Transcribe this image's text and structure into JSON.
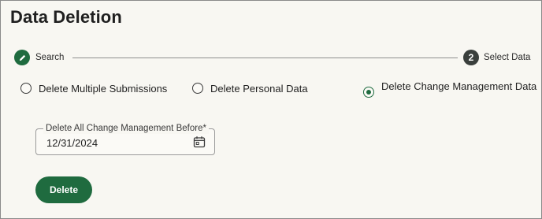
{
  "page": {
    "title": "Data Deletion"
  },
  "stepper": {
    "steps": [
      {
        "label": "Search",
        "icon": "pencil-icon",
        "state": "completed"
      },
      {
        "label": "Select Data",
        "number": "2",
        "state": "active"
      }
    ]
  },
  "options": {
    "items": [
      {
        "label": "Delete Multiple Submissions",
        "selected": false
      },
      {
        "label": "Delete Personal Data",
        "selected": false
      },
      {
        "label": "Delete Change Management Data",
        "selected": true
      }
    ]
  },
  "date_field": {
    "label": "Delete All Change Management Before*",
    "value": "12/31/2024",
    "icon": "calendar-icon"
  },
  "actions": {
    "delete_label": "Delete"
  },
  "colors": {
    "accent": "#1f6b3f",
    "step_active": "#3a3f3c",
    "background": "#f8f7f2"
  }
}
